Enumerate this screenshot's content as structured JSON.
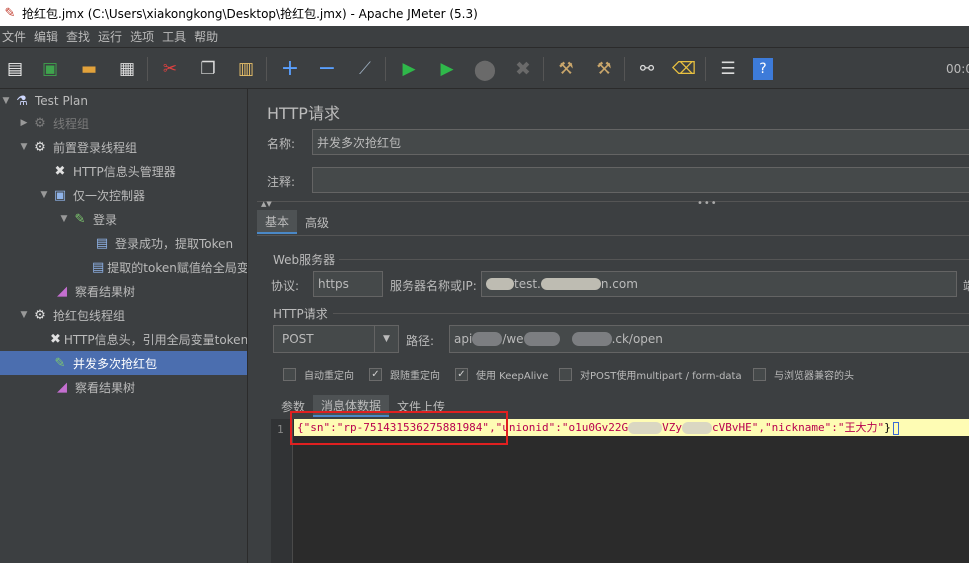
{
  "window": {
    "title": "抢红包.jmx (C:\\Users\\xiakongkong\\Desktop\\抢红包.jmx) - Apache JMeter (5.3)"
  },
  "menu": [
    "文件",
    "编辑",
    "查找",
    "运行",
    "选项",
    "工具",
    "帮助"
  ],
  "toolbar": {
    "icons": [
      "new-icon",
      "templates-icon",
      "open-icon",
      "save-icon",
      "cut-icon",
      "copy-icon",
      "paste-icon",
      "expand-icon",
      "collapse-icon",
      "toggle-icon",
      "start-icon",
      "start-no-pause-icon",
      "stop-icon",
      "shutdown-icon",
      "clear-icon",
      "clear-all-icon",
      "search-icon",
      "reset-search-icon",
      "function-helper-icon",
      "help-icon"
    ],
    "elapsed_time": "00:0"
  },
  "tree": [
    {
      "label": "Test Plan",
      "level": 0,
      "expanded": true
    },
    {
      "label": "线程组",
      "level": 1,
      "expanded": false,
      "disabled": true
    },
    {
      "label": "前置登录线程组",
      "level": 1,
      "expanded": true
    },
    {
      "label": "HTTP信息头管理器",
      "level": 2
    },
    {
      "label": "仅一次控制器",
      "level": 2,
      "expanded": true
    },
    {
      "label": "登录",
      "level": 3,
      "expanded": true
    },
    {
      "label": "登录成功，提取Token",
      "level": 4
    },
    {
      "label": "提取的token赋值给全局变",
      "level": 4
    },
    {
      "label": "察看结果树",
      "level": 2
    },
    {
      "label": "抢红包线程组",
      "level": 1,
      "expanded": true
    },
    {
      "label": "HTTP信息头，引用全局变量token",
      "level": 2
    },
    {
      "label": "并发多次抢红包",
      "level": 2,
      "selected": true
    },
    {
      "label": "察看结果树",
      "level": 2
    }
  ],
  "panel": {
    "title": "HTTP请求",
    "name_label": "名称:",
    "name_value": "并发多次抢红包",
    "comment_label": "注释:",
    "comment_value": "",
    "tabs": [
      "基本",
      "高级"
    ],
    "web_server": {
      "group_label": "Web服务器",
      "protocol_label": "协议:",
      "protocol_value": "https",
      "server_label": "服务器名称或IP:",
      "server_value_a": "test.",
      "server_value_b": "n.com",
      "port_label": "端"
    },
    "http_request": {
      "group_label": "HTTP请求",
      "method": "POST",
      "path_label": "路径:",
      "path_a": "api",
      "path_b": "/we",
      "path_c": ".ck/open"
    },
    "options": [
      {
        "label": "自动重定向",
        "checked": false
      },
      {
        "label": "跟随重定向",
        "checked": true
      },
      {
        "label": "使用 KeepAlive",
        "checked": true
      },
      {
        "label": "对POST使用multipart / form-data",
        "checked": false
      },
      {
        "label": "与浏览器兼容的头",
        "checked": false
      }
    ],
    "body_tabs": [
      "参数",
      "消息体数据",
      "文件上传"
    ],
    "body": {
      "line_number": "1",
      "p1": "{\"sn\":\"rp-751431536275881984\"",
      "p2": ",\"unionid\":\"o1u0Gv22G",
      "p3": "VZy",
      "p4": "cVBvHE\",\"nickname\":\"王大力\"",
      "p5": "}"
    }
  },
  "colors": {
    "selection": "#4b6eaf",
    "highlight_box": "#e02020",
    "code_line": "#fefcb4"
  }
}
